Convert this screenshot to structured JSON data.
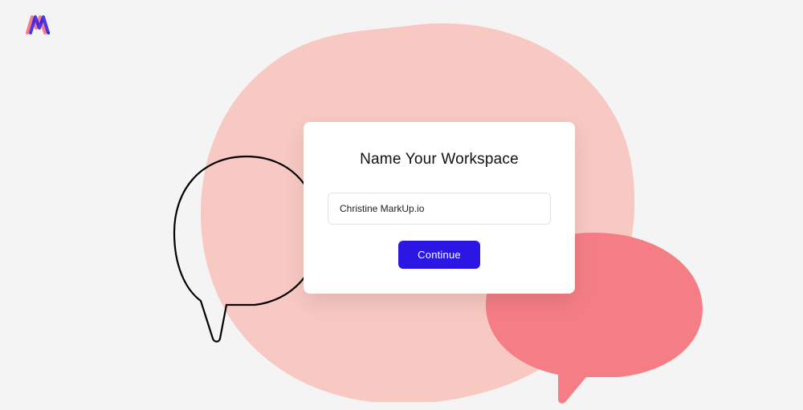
{
  "brand": {
    "name": "markup-logo"
  },
  "card": {
    "title": "Name Your Workspace",
    "workspace_value": "Christine MarkUp.io",
    "continue_label": "Continue"
  },
  "colors": {
    "accent": "#2b16e4",
    "blob": "#f8c9c2",
    "bubble": "#f57e86",
    "page_bg": "#f4f4f4"
  }
}
